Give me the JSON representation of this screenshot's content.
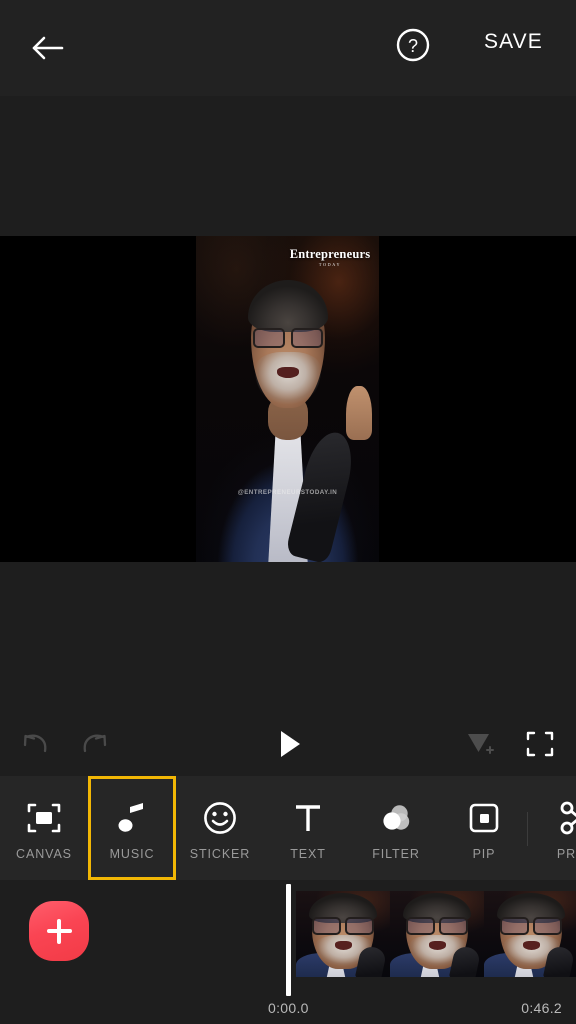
{
  "topbar": {
    "back_icon": "back-arrow-icon",
    "help_icon": "help-circle-icon",
    "save_label": "SAVE"
  },
  "preview": {
    "watermark_top_main": "Entrepreneurs",
    "watermark_top_sub": "TODAY",
    "watermark_bottom": "@ENTREPRENEURSTODAY.IN"
  },
  "controls": {
    "undo_icon": "undo-arrow-icon",
    "redo_icon": "redo-arrow-icon",
    "play_icon": "play-triangle-icon",
    "transition_icon": "add-transition-icon",
    "fullscreen_icon": "fullscreen-expand-icon"
  },
  "toolbar": {
    "active_index": 1,
    "items": [
      {
        "label": "CANVAS",
        "icon": "canvas-crop-icon"
      },
      {
        "label": "MUSIC",
        "icon": "music-note-icon"
      },
      {
        "label": "STICKER",
        "icon": "smiley-face-icon"
      },
      {
        "label": "TEXT",
        "icon": "text-t-icon"
      },
      {
        "label": "FILTER",
        "icon": "filter-circles-icon"
      },
      {
        "label": "PIP",
        "icon": "picture-in-picture-icon"
      },
      {
        "label": "PREC",
        "icon": "scissors-icon"
      }
    ]
  },
  "timeline": {
    "add_clip_label": "+",
    "add_clip_icon": "add-plus-icon",
    "time_start": "0:00.0",
    "time_end": "0:46.2",
    "thumbnail_count": 3
  },
  "colors": {
    "accent_highlight": "#f2b705",
    "add_button": "#fa4453",
    "toolbar_bg": "#262626",
    "app_bg": "#1e1e1e",
    "topbar_bg": "#222222",
    "label_text": "#9a9a9a"
  }
}
